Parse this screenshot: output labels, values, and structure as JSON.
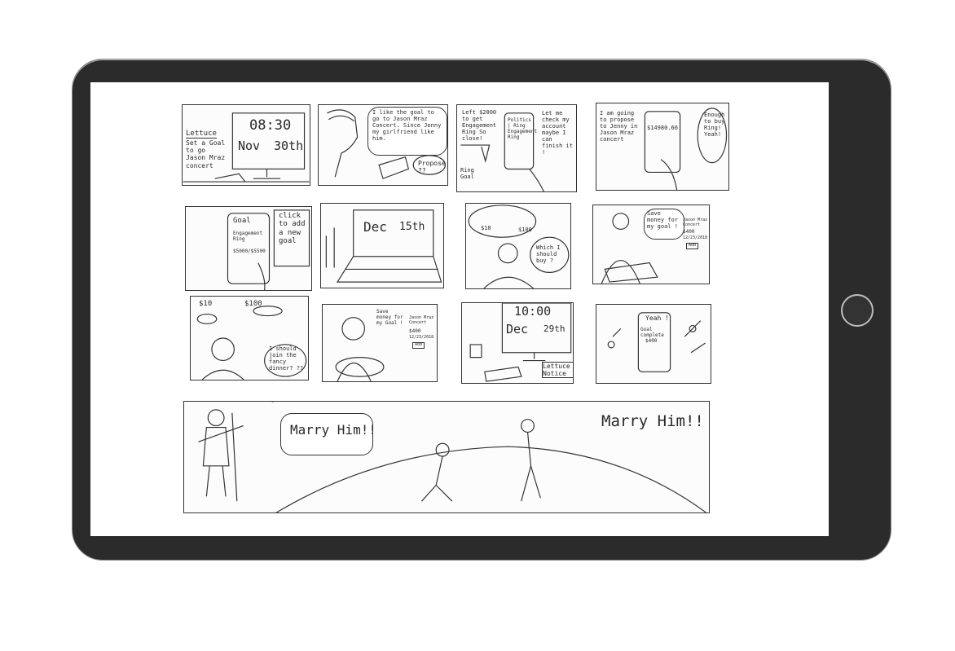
{
  "panels": {
    "p1": {
      "note_title": "Lettuce",
      "note_body": "Set a Goal to go Jason Mraz concert",
      "time": "08:30",
      "date_month": "Nov",
      "date_day": "30th"
    },
    "p2": {
      "speech": "I like the goal to go to Jason Mraz Concert. Since Jenny my girlfriend like him.",
      "thought": "Propose ??"
    },
    "p3": {
      "left_text": "Left $2000 to get Engagement Ring So close!",
      "phone_lines": "Politics | Ring Engagement Ring",
      "ring_label": "Ring Goal",
      "right_text": "Let me check my account maybe I can finish it !"
    },
    "p4": {
      "left_text": "I am going to propose to Jenny in Jason Mraz concert",
      "balance": "$14980.66",
      "right_text": "Enough to buy Ring! Yeah!"
    },
    "p5": {
      "phone_title": "Goal",
      "phone_item": "Engagement Ring",
      "phone_amount": "$5000/$5500",
      "callout": "click to add a new goal"
    },
    "p6": {
      "date_month": "Dec",
      "date_day": "15th"
    },
    "p7": {
      "price_a": "$10",
      "price_b": "$100",
      "thought": "Which I should buy ?"
    },
    "p8": {
      "speech": "Save money for my goal !",
      "card_title": "Jason Mraz Concert",
      "card_amount": "$400",
      "card_date": "12/23/2018",
      "card_button": "Add"
    },
    "p9": {
      "price_a": "$10",
      "price_b": "$100",
      "thought": "I should join the fancy dinner? ??"
    },
    "p10": {
      "speech": "Save money for my Goal !",
      "card_title": "Jason Mraz Concert",
      "card_amount": "$400",
      "card_date": "12/23/2018",
      "card_button": "Add"
    },
    "p11": {
      "time": "10:00",
      "date_month": "Dec",
      "date_day": "29th",
      "note": "Lettuce Notice"
    },
    "p12": {
      "phone_top": "Yeah !",
      "phone_title": "Goal complete",
      "phone_amount": "$400"
    },
    "p13": {
      "left_bubble": "Marry Him!!",
      "right_bubble": "Marry Him!!",
      "music": "♪♫"
    }
  }
}
